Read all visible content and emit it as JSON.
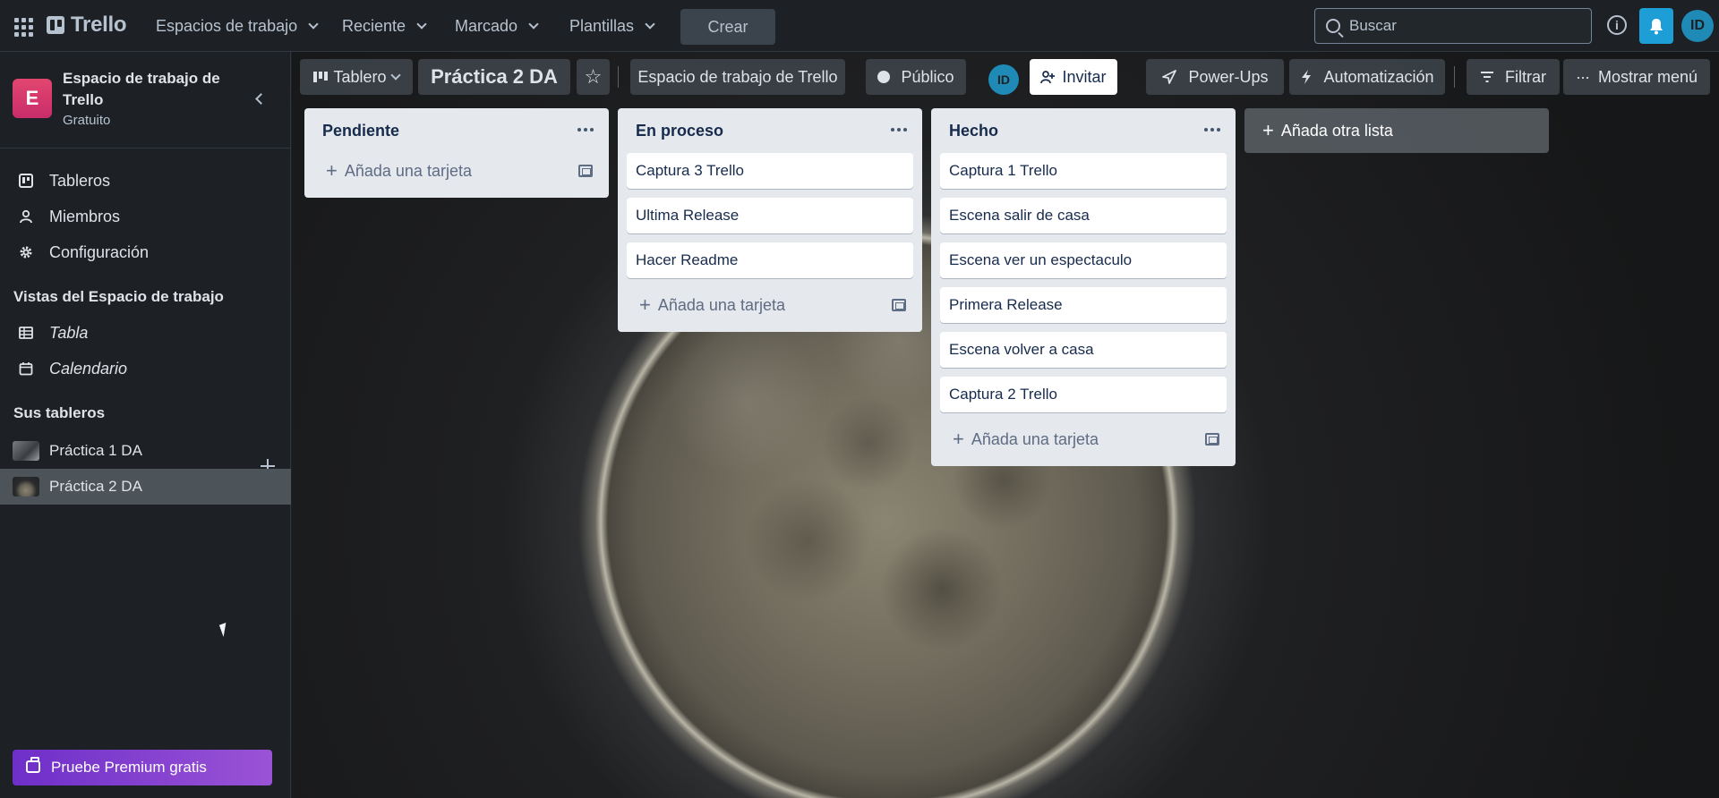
{
  "topnav": {
    "logo_text": "Trello",
    "menus": [
      {
        "label": "Espacios de trabajo"
      },
      {
        "label": "Reciente"
      },
      {
        "label": "Marcado"
      },
      {
        "label": "Plantillas"
      }
    ],
    "create_label": "Crear",
    "search_placeholder": "Buscar",
    "info_icon": "i",
    "user_initials": "ID"
  },
  "sidebar": {
    "workspace_initial": "E",
    "workspace_name": "Espacio de trabajo de Trello",
    "workspace_plan": "Gratuito",
    "items": [
      {
        "label": "Tableros",
        "icon": "board-icon"
      },
      {
        "label": "Miembros",
        "icon": "person-icon"
      },
      {
        "label": "Configuración",
        "icon": "gear-icon"
      }
    ],
    "views_title": "Vistas del Espacio de trabajo",
    "views": [
      {
        "label": "Tabla",
        "icon": "table-icon"
      },
      {
        "label": "Calendario",
        "icon": "calendar-icon"
      }
    ],
    "boards_title": "Sus tableros",
    "boards": [
      {
        "label": "Práctica 1 DA",
        "active": false
      },
      {
        "label": "Práctica 2 DA",
        "active": true
      }
    ],
    "premium_label": "Pruebe Premium gratis"
  },
  "board_header": {
    "view_label": "Tablero",
    "board_title": "Práctica 2 DA",
    "star_icon": "☆",
    "workspace_label": "Espacio de trabajo de Trello",
    "visibility_label": "Público",
    "member_initials": "ID",
    "invite_label": "Invitar",
    "powerups_label": "Power-Ups",
    "automation_label": "Automatización",
    "filter_label": "Filtrar",
    "menu_label": "Mostrar menú"
  },
  "lists": [
    {
      "title": "Pendiente",
      "cards": [],
      "add_label": "Añada una tarjeta"
    },
    {
      "title": "En proceso",
      "cards": [
        "Captura 3 Trello",
        "Ultima Release",
        "Hacer Readme"
      ],
      "add_label": "Añada una tarjeta"
    },
    {
      "title": "Hecho",
      "cards": [
        "Captura 1 Trello",
        "Escena salir de casa",
        "Escena ver un espectaculo",
        "Primera Release",
        "Escena volver a casa",
        "Captura 2 Trello"
      ],
      "add_label": "Añada una tarjeta"
    }
  ],
  "add_list_label": "Añada otra lista",
  "colors": {
    "accent_blue": "#1d9ed6",
    "workspace_pink": "#e2466f",
    "premium_purple": "#7b3fd0"
  }
}
